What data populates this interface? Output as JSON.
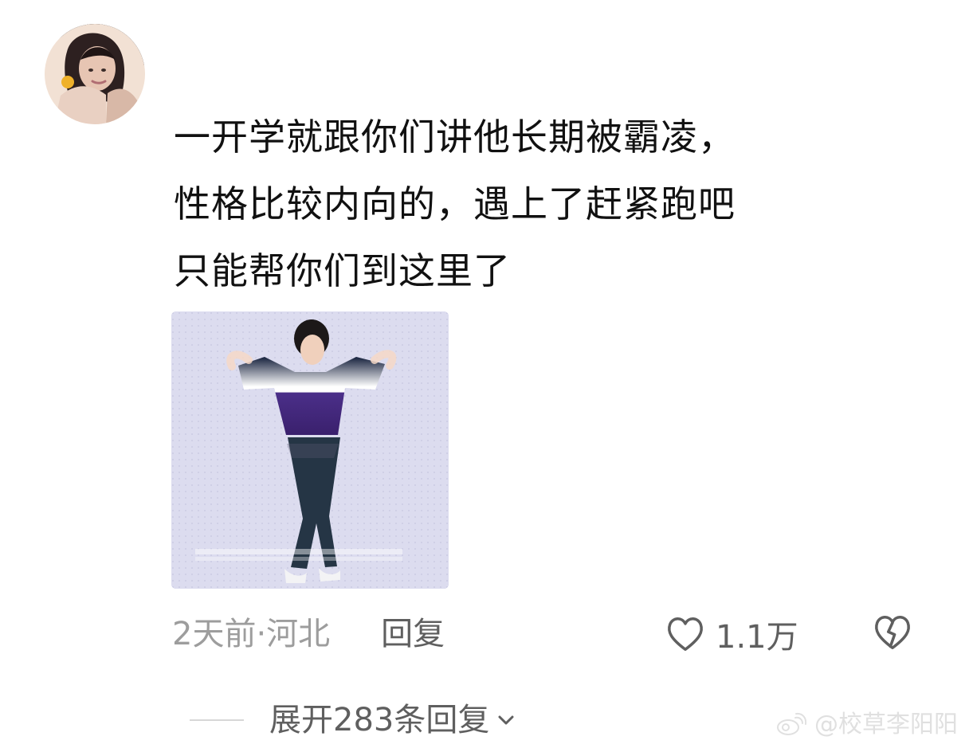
{
  "comment": {
    "text": "一开学就跟你们讲他长期被霸凌，\n性格比较内向的，遇上了赶紧跑吧\n只能帮你们到这里了"
  },
  "meta": {
    "time": "2天前",
    "separator": " · ",
    "location": "河北",
    "reply_label": "回复"
  },
  "actions": {
    "like_count": "1.1万"
  },
  "expand": {
    "label": "展开283条回复"
  },
  "watermark": {
    "text": "@校草李阳阳"
  },
  "icons": {
    "avatar": "avatar-icon",
    "like": "heart-outline-icon",
    "dislike": "broken-heart-icon",
    "expand": "chevron-down-icon",
    "watermark": "weibo-icon"
  },
  "colors": {
    "text": "#111111",
    "meta": "#9d9d9d",
    "action": "#5f5f5f",
    "divider": "#d7d7d7",
    "media_bg": "#dcdcef"
  }
}
